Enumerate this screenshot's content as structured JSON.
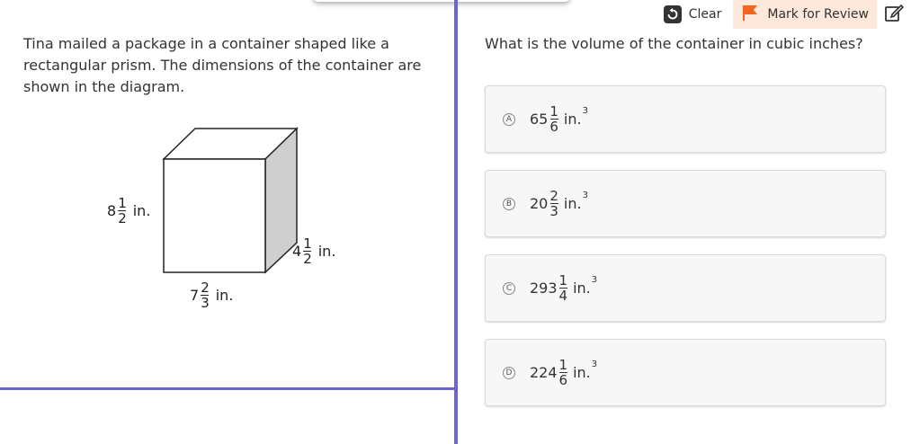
{
  "toolbar": {
    "clear_label": "Clear",
    "mark_label": "Mark for Review",
    "flag_color": "#f26522"
  },
  "left": {
    "stem": "Tina mailed a package in a container shaped like a rectangular prism. The dimensions of the container are shown in the diagram.",
    "dims": {
      "height": {
        "whole": "8",
        "num": "1",
        "den": "2",
        "unit": "in."
      },
      "length": {
        "whole": "7",
        "num": "2",
        "den": "3",
        "unit": "in."
      },
      "width": {
        "whole": "4",
        "num": "1",
        "den": "2",
        "unit": "in."
      }
    }
  },
  "right": {
    "question": "What is the volume of the container in cubic inches?",
    "choices": [
      {
        "letter": "A",
        "whole": "65",
        "num": "1",
        "den": "6",
        "unit": "in.",
        "exp": "3"
      },
      {
        "letter": "B",
        "whole": "20",
        "num": "2",
        "den": "3",
        "unit": "in.",
        "exp": "3"
      },
      {
        "letter": "C",
        "whole": "293",
        "num": "1",
        "den": "4",
        "unit": "in.",
        "exp": "3"
      },
      {
        "letter": "D",
        "whole": "224",
        "num": "1",
        "den": "6",
        "unit": "in.",
        "exp": "3"
      }
    ]
  },
  "colors": {
    "accent": "#6a67d0",
    "mark_bg": "#fde8dc"
  }
}
